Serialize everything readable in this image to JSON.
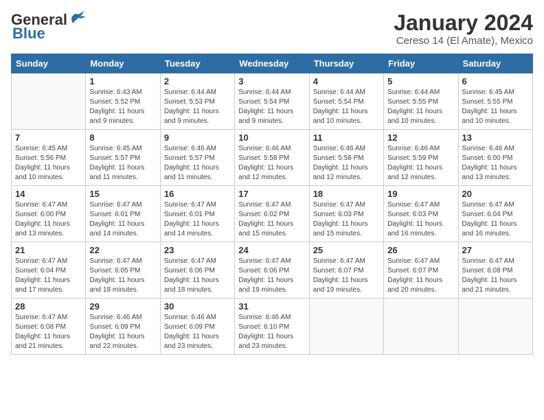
{
  "logo": {
    "general": "General",
    "blue": "Blue"
  },
  "title": "January 2024",
  "subtitle": "Cereso 14 (El Amate), Mexico",
  "days_header": [
    "Sunday",
    "Monday",
    "Tuesday",
    "Wednesday",
    "Thursday",
    "Friday",
    "Saturday"
  ],
  "weeks": [
    [
      {
        "num": "",
        "info": ""
      },
      {
        "num": "1",
        "info": "Sunrise: 6:43 AM\nSunset: 5:52 PM\nDaylight: 11 hours\nand 9 minutes."
      },
      {
        "num": "2",
        "info": "Sunrise: 6:44 AM\nSunset: 5:53 PM\nDaylight: 11 hours\nand 9 minutes."
      },
      {
        "num": "3",
        "info": "Sunrise: 6:44 AM\nSunset: 5:54 PM\nDaylight: 11 hours\nand 9 minutes."
      },
      {
        "num": "4",
        "info": "Sunrise: 6:44 AM\nSunset: 5:54 PM\nDaylight: 11 hours\nand 10 minutes."
      },
      {
        "num": "5",
        "info": "Sunrise: 6:44 AM\nSunset: 5:55 PM\nDaylight: 11 hours\nand 10 minutes."
      },
      {
        "num": "6",
        "info": "Sunrise: 6:45 AM\nSunset: 5:55 PM\nDaylight: 11 hours\nand 10 minutes."
      }
    ],
    [
      {
        "num": "7",
        "info": "Sunrise: 6:45 AM\nSunset: 5:56 PM\nDaylight: 11 hours\nand 10 minutes."
      },
      {
        "num": "8",
        "info": "Sunrise: 6:45 AM\nSunset: 5:57 PM\nDaylight: 11 hours\nand 11 minutes."
      },
      {
        "num": "9",
        "info": "Sunrise: 6:46 AM\nSunset: 5:57 PM\nDaylight: 11 hours\nand 11 minutes."
      },
      {
        "num": "10",
        "info": "Sunrise: 6:46 AM\nSunset: 5:58 PM\nDaylight: 11 hours\nand 12 minutes."
      },
      {
        "num": "11",
        "info": "Sunrise: 6:46 AM\nSunset: 5:58 PM\nDaylight: 11 hours\nand 12 minutes."
      },
      {
        "num": "12",
        "info": "Sunrise: 6:46 AM\nSunset: 5:59 PM\nDaylight: 11 hours\nand 12 minutes."
      },
      {
        "num": "13",
        "info": "Sunrise: 6:46 AM\nSunset: 6:00 PM\nDaylight: 11 hours\nand 13 minutes."
      }
    ],
    [
      {
        "num": "14",
        "info": "Sunrise: 6:47 AM\nSunset: 6:00 PM\nDaylight: 11 hours\nand 13 minutes."
      },
      {
        "num": "15",
        "info": "Sunrise: 6:47 AM\nSunset: 6:01 PM\nDaylight: 11 hours\nand 14 minutes."
      },
      {
        "num": "16",
        "info": "Sunrise: 6:47 AM\nSunset: 6:01 PM\nDaylight: 11 hours\nand 14 minutes."
      },
      {
        "num": "17",
        "info": "Sunrise: 6:47 AM\nSunset: 6:02 PM\nDaylight: 11 hours\nand 15 minutes."
      },
      {
        "num": "18",
        "info": "Sunrise: 6:47 AM\nSunset: 6:03 PM\nDaylight: 11 hours\nand 15 minutes."
      },
      {
        "num": "19",
        "info": "Sunrise: 6:47 AM\nSunset: 6:03 PM\nDaylight: 11 hours\nand 16 minutes."
      },
      {
        "num": "20",
        "info": "Sunrise: 6:47 AM\nSunset: 6:04 PM\nDaylight: 11 hours\nand 16 minutes."
      }
    ],
    [
      {
        "num": "21",
        "info": "Sunrise: 6:47 AM\nSunset: 6:04 PM\nDaylight: 11 hours\nand 17 minutes."
      },
      {
        "num": "22",
        "info": "Sunrise: 6:47 AM\nSunset: 6:05 PM\nDaylight: 11 hours\nand 18 minutes."
      },
      {
        "num": "23",
        "info": "Sunrise: 6:47 AM\nSunset: 6:06 PM\nDaylight: 11 hours\nand 18 minutes."
      },
      {
        "num": "24",
        "info": "Sunrise: 6:47 AM\nSunset: 6:06 PM\nDaylight: 11 hours\nand 19 minutes."
      },
      {
        "num": "25",
        "info": "Sunrise: 6:47 AM\nSunset: 6:07 PM\nDaylight: 11 hours\nand 19 minutes."
      },
      {
        "num": "26",
        "info": "Sunrise: 6:47 AM\nSunset: 6:07 PM\nDaylight: 11 hours\nand 20 minutes."
      },
      {
        "num": "27",
        "info": "Sunrise: 6:47 AM\nSunset: 6:08 PM\nDaylight: 11 hours\nand 21 minutes."
      }
    ],
    [
      {
        "num": "28",
        "info": "Sunrise: 6:47 AM\nSunset: 6:08 PM\nDaylight: 11 hours\nand 21 minutes."
      },
      {
        "num": "29",
        "info": "Sunrise: 6:46 AM\nSunset: 6:09 PM\nDaylight: 11 hours\nand 22 minutes."
      },
      {
        "num": "30",
        "info": "Sunrise: 6:46 AM\nSunset: 6:09 PM\nDaylight: 11 hours\nand 23 minutes."
      },
      {
        "num": "31",
        "info": "Sunrise: 6:46 AM\nSunset: 6:10 PM\nDaylight: 11 hours\nand 23 minutes."
      },
      {
        "num": "",
        "info": ""
      },
      {
        "num": "",
        "info": ""
      },
      {
        "num": "",
        "info": ""
      }
    ]
  ]
}
